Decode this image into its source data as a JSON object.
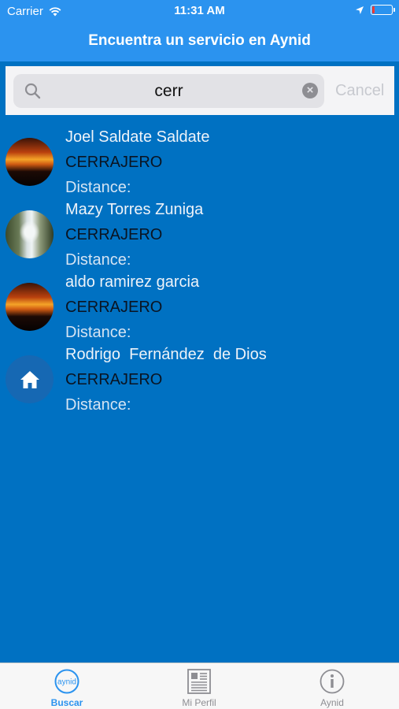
{
  "status_bar": {
    "carrier": "Carrier",
    "time": "11:31 AM",
    "battery_level": 0.12,
    "battery_color": "#ff3b30"
  },
  "nav": {
    "title": "Encuentra un servicio en Aynid"
  },
  "search": {
    "query": "cerr",
    "cancel_label": "Cancel"
  },
  "results": [
    {
      "name": "Joel Saldate Saldate",
      "category": "CERRAJERO",
      "distance_label": "Distance:",
      "avatar": "sunset-photo"
    },
    {
      "name": "Mazy Torres Zuniga",
      "category": "CERRAJERO",
      "distance_label": "Distance:",
      "avatar": "waterfall-photo"
    },
    {
      "name": "aldo ramirez garcia",
      "category": "CERRAJERO",
      "distance_label": "Distance:",
      "avatar": "sunset-photo"
    },
    {
      "name": "Rodrigo  Fernández  de Dios",
      "category": "CERRAJERO",
      "distance_label": "Distance:",
      "avatar": "home-icon"
    }
  ],
  "tab_bar": {
    "tabs": [
      {
        "label": "Buscar",
        "icon": "aynid-logo-icon",
        "icon_text": "aynid",
        "active": true
      },
      {
        "label": "Mi Perfil",
        "icon": "profile-document-icon",
        "active": false
      },
      {
        "label": "Aynid",
        "icon": "info-icon",
        "active": false
      }
    ]
  },
  "colors": {
    "nav_background": "#2b93ef",
    "list_background": "#0071c2",
    "accent": "#2b93ef"
  }
}
